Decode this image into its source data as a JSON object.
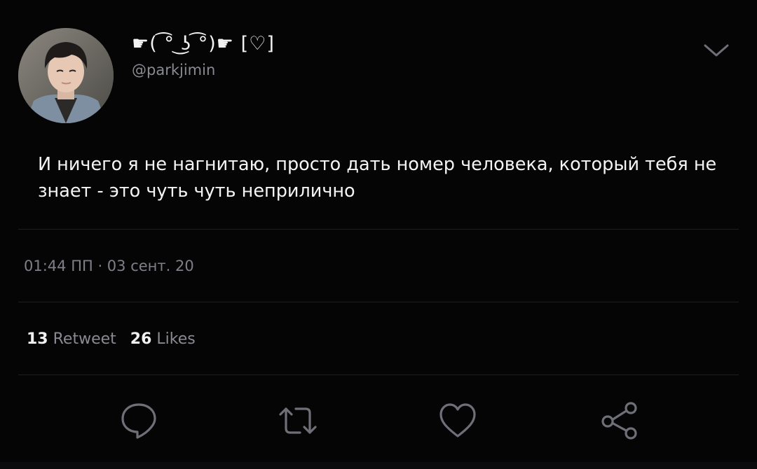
{
  "tweet": {
    "display_name": "☛( ͡° ͜ʖ ͡°)☛ [♡]",
    "handle": "@parkjimin",
    "text": "И ничего я не нагнитаю, просто дать номер человека, который тебя не знает - это чуть чуть неприлично",
    "timestamp": "01:44 ПП · 03 сент. 20",
    "retweet_count": "13",
    "retweet_label": "Retweet",
    "like_count": "26",
    "like_label": "Likes"
  },
  "icons": {
    "menu": "chevron-down-icon",
    "reply": "reply-bubble-icon",
    "retweet": "retweet-arrows-icon",
    "like": "heart-icon",
    "share": "share-nodes-icon"
  },
  "colors": {
    "background": "#050506",
    "text": "#f4f4f4",
    "muted": "#8a8a92",
    "divider": "#1d1d22",
    "icon": "#6f6f78"
  }
}
